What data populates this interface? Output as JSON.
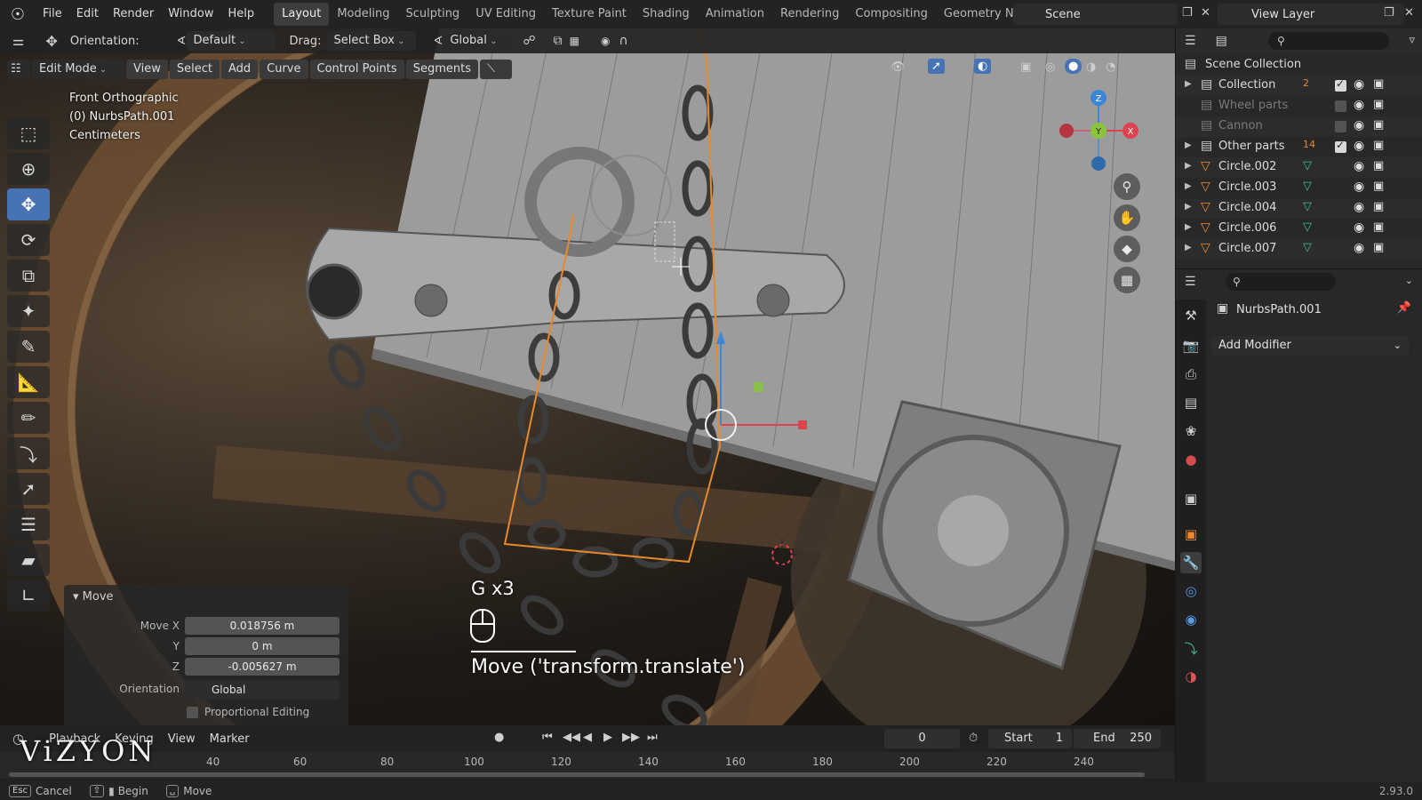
{
  "topbar": {
    "menus": [
      "File",
      "Edit",
      "Render",
      "Window",
      "Help"
    ],
    "workspaces": [
      "Layout",
      "Modeling",
      "Sculpting",
      "UV Editing",
      "Texture Paint",
      "Shading",
      "Animation",
      "Rendering",
      "Compositing",
      "Geometry Nod"
    ],
    "active_workspace": "Layout",
    "scene": "Scene",
    "view_layer": "View Layer"
  },
  "viewport_header": {
    "orientation_label": "Orientation:",
    "orientation_value": "Default",
    "drag_label": "Drag:",
    "drag_value": "Select Box",
    "transform_value": "Global"
  },
  "viewport_header2": {
    "mode": "Edit Mode",
    "menus": [
      "View",
      "Select",
      "Add",
      "Curve",
      "Control Points",
      "Segments"
    ]
  },
  "overlay_info": {
    "view": "Front Orthographic",
    "object": "(0) NurbsPath.001",
    "units": "Centimeters"
  },
  "axis_gizmo": {
    "z": "Z",
    "y": "Y",
    "x": "X"
  },
  "operator_panel": {
    "title": "Move",
    "move_x_label": "Move X",
    "move_x": "0.018756 m",
    "y_label": "Y",
    "y": "0 m",
    "z_label": "Z",
    "z": "-0.005627 m",
    "orientation_label": "Orientation",
    "orientation": "Global",
    "proportional_label": "Proportional Editing"
  },
  "keystroke": {
    "key": "G x3",
    "operator": "Move ('transform.translate')"
  },
  "timeline": {
    "menus": [
      "Playback",
      "Keying",
      "View",
      "Marker"
    ],
    "current_frame": "0",
    "start_label": "Start",
    "start": "1",
    "end_label": "End",
    "end": "250",
    "ticks": [
      "40",
      "60",
      "80",
      "100",
      "120",
      "140",
      "160",
      "180",
      "200",
      "220",
      "240"
    ]
  },
  "statusbar": {
    "cancel": "Cancel",
    "begin": "Begin",
    "move": "Move",
    "version": "2.93.0"
  },
  "watermark": "ViZYON",
  "outliner": {
    "root": "Scene Collection",
    "rows": [
      {
        "name": "Collection",
        "type": "collection",
        "expand": true,
        "dim": false,
        "checked": true,
        "extra": "2"
      },
      {
        "name": "Wheel parts",
        "type": "collection",
        "expand": false,
        "dim": true,
        "checked": false,
        "extra": ""
      },
      {
        "name": "Cannon",
        "type": "collection",
        "expand": false,
        "dim": true,
        "checked": false,
        "extra": ""
      },
      {
        "name": "Other parts",
        "type": "collection",
        "expand": true,
        "dim": false,
        "checked": true,
        "extra": "14"
      },
      {
        "name": "Circle.002",
        "type": "object",
        "expand": true,
        "dim": false,
        "checked": null,
        "extra": ""
      },
      {
        "name": "Circle.003",
        "type": "object",
        "expand": true,
        "dim": false,
        "checked": null,
        "extra": ""
      },
      {
        "name": "Circle.004",
        "type": "object",
        "expand": true,
        "dim": false,
        "checked": null,
        "extra": ""
      },
      {
        "name": "Circle.006",
        "type": "object",
        "expand": true,
        "dim": false,
        "checked": null,
        "extra": ""
      },
      {
        "name": "Circle.007",
        "type": "object",
        "expand": true,
        "dim": false,
        "checked": null,
        "extra": ""
      }
    ]
  },
  "properties": {
    "object_name": "NurbsPath.001",
    "add_modifier": "Add Modifier"
  },
  "colors": {
    "accent": "#4772b3",
    "selection_orange": "#e8892c",
    "axis_x": "#e04250",
    "axis_y": "#8ac43d",
    "axis_z": "#3c86d8"
  }
}
